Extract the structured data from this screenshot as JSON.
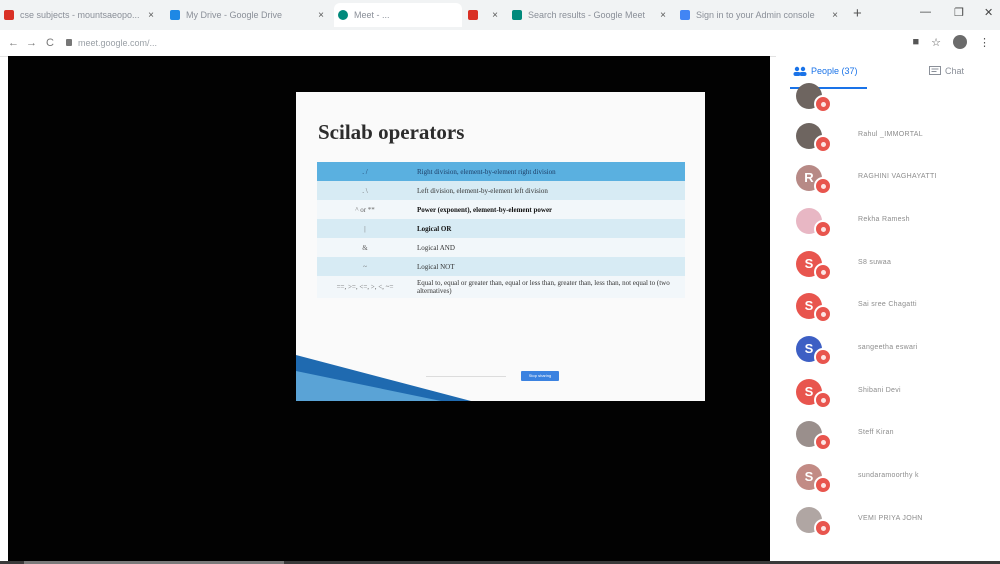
{
  "browser": {
    "tabs": [
      {
        "label": "cse subjects - mountsaeopo...",
        "icon_color": "#d93025",
        "active": false
      },
      {
        "label": "My Drive - Google Drive",
        "icon_color": "#1e88e5",
        "active": false
      },
      {
        "label": "Meet - ...",
        "icon_color": "#00897b",
        "active": true
      },
      {
        "label": "",
        "icon_color": "#d93025",
        "active": false
      },
      {
        "label": "Search results - Google Meet",
        "icon_color": "#00897b",
        "active": false
      },
      {
        "label": "Sign in to your Admin console",
        "icon_color": "#4285f4",
        "active": false
      }
    ],
    "new_tab_symbol": "+",
    "url": "meet.google.com/...",
    "back_symbol": "←",
    "forward_symbol": "→",
    "reload_symbol": "C",
    "minimize_symbol": "—",
    "restore_symbol": "❐",
    "close_symbol": "✕",
    "star_symbol": "☆",
    "menu_symbol": "⋮",
    "tab_close_symbol": "×"
  },
  "slide": {
    "title": "Scilab operators",
    "rows": [
      {
        "op": ". /",
        "desc": "Right division, element-by-element right division",
        "style": "hdr",
        "bold": false
      },
      {
        "op": ". \\",
        "desc": "Left division, element-by-element left division",
        "style": "band",
        "bold": false
      },
      {
        "op": "^ or **",
        "desc": "Power (exponent), element-by-element power",
        "style": "plain",
        "bold": true
      },
      {
        "op": "|",
        "desc": "Logical OR",
        "style": "band",
        "bold": true
      },
      {
        "op": "&",
        "desc": "Logical AND",
        "style": "plain",
        "bold": false
      },
      {
        "op": "~",
        "desc": "Logical NOT",
        "style": "band",
        "bold": false
      },
      {
        "op": "==, >=, <=, >, <, ~=",
        "desc": "Equal to, equal or greater than, equal or less than, greater than, less than, not equal to (two alternatives)",
        "style": "plain",
        "bold": false
      }
    ],
    "button_label": "Stop sharing"
  },
  "panel": {
    "people_label": "People (37)",
    "chat_label": "Chat",
    "people_icon": "people-icon",
    "chat_icon": "chat-icon",
    "people": [
      {
        "name": "",
        "initial": "",
        "color": "#6e6560",
        "photo": true
      },
      {
        "name": "Rahul _IMMORTAL",
        "initial": "",
        "color": "#6e6560",
        "photo": true
      },
      {
        "name": "RAGHINI VAGHAYATTI",
        "initial": "R",
        "color": "#b78a86",
        "photo": false
      },
      {
        "name": "Rekha Ramesh",
        "initial": "",
        "color": "#e8b7c4",
        "photo": true
      },
      {
        "name": "S8 suwaa",
        "initial": "S",
        "color": "#e8554e",
        "photo": false
      },
      {
        "name": "Sai sree Chagatti",
        "initial": "S",
        "color": "#e8554e",
        "photo": false
      },
      {
        "name": "sangeetha eswari",
        "initial": "S",
        "color": "#3d5fc4",
        "photo": false
      },
      {
        "name": "Shibani Devi",
        "initial": "S",
        "color": "#e8554e",
        "photo": false
      },
      {
        "name": "Steff Kiran",
        "initial": "",
        "color": "#9a8f8c",
        "photo": true
      },
      {
        "name": "sundaramoorthy k",
        "initial": "S",
        "color": "#c28b85",
        "photo": false
      },
      {
        "name": "VEMI PRIYA JOHN",
        "initial": "",
        "color": "#b0a6a3",
        "photo": true
      }
    ]
  }
}
